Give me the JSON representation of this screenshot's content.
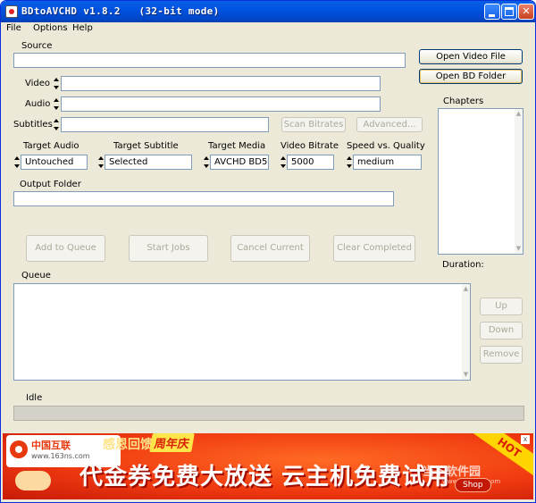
{
  "window": {
    "title": "BDtoAVCHD v1.8.2   (32-bit mode)",
    "min_glyph": "_",
    "max_glyph": "□",
    "close_glyph": "✕"
  },
  "menu": [
    {
      "label": "File",
      "key": "F"
    },
    {
      "label": "Options",
      "key": "O"
    },
    {
      "label": "Help",
      "key": "H"
    }
  ],
  "source": {
    "label": "Source",
    "value": ""
  },
  "buttons": {
    "open_video_file": "Open Video File",
    "open_bd_folder": "Open BD Folder",
    "scan_bitrates": "Scan Bitrates",
    "advanced": "Advanced...",
    "add_to_queue": "Add to Queue",
    "start_jobs": "Start Jobs",
    "cancel_current": "Cancel Current",
    "clear_completed": "Clear Completed",
    "up": "Up",
    "down": "Down",
    "remove": "Remove"
  },
  "fields": {
    "video_label": "Video",
    "audio_label": "Audio",
    "subtitles_label": "Subtitles",
    "video_value": "",
    "audio_value": "",
    "subtitles_value": ""
  },
  "options": {
    "target_audio": {
      "label": "Target Audio",
      "value": "Untouched"
    },
    "target_subtitle": {
      "label": "Target Subtitle",
      "value": "Selected"
    },
    "target_media": {
      "label": "Target Media",
      "value": "AVCHD BD5"
    },
    "video_bitrate": {
      "label": "Video Bitrate",
      "value": "5000"
    },
    "speed_quality": {
      "label": "Speed vs. Quality",
      "value": "medium"
    }
  },
  "output_folder": {
    "label": "Output Folder",
    "value": ""
  },
  "chapters": {
    "label": "Chapters",
    "items": []
  },
  "duration": {
    "label": "Duration:",
    "value": ""
  },
  "queue": {
    "label": "Queue",
    "items": []
  },
  "status": {
    "text": "Idle",
    "progress": 0.0
  },
  "banner": {
    "brand": "中国互联",
    "brand_url": "www.163ns.com",
    "thanks": "感恩回馈",
    "anniversary": "周年庆",
    "headline": "代金券免费大放送 云主机免费试用",
    "hot": "HOT",
    "shop_button": "Shop",
    "close": "x",
    "watermark": "当下软件园",
    "watermark_url": "www.downxia.com"
  },
  "colors": {
    "titlebar": "#0053e0",
    "window_bg": "#ece9d8",
    "banner_red": "#f03a10",
    "hot_yellow": "#ffd400"
  }
}
